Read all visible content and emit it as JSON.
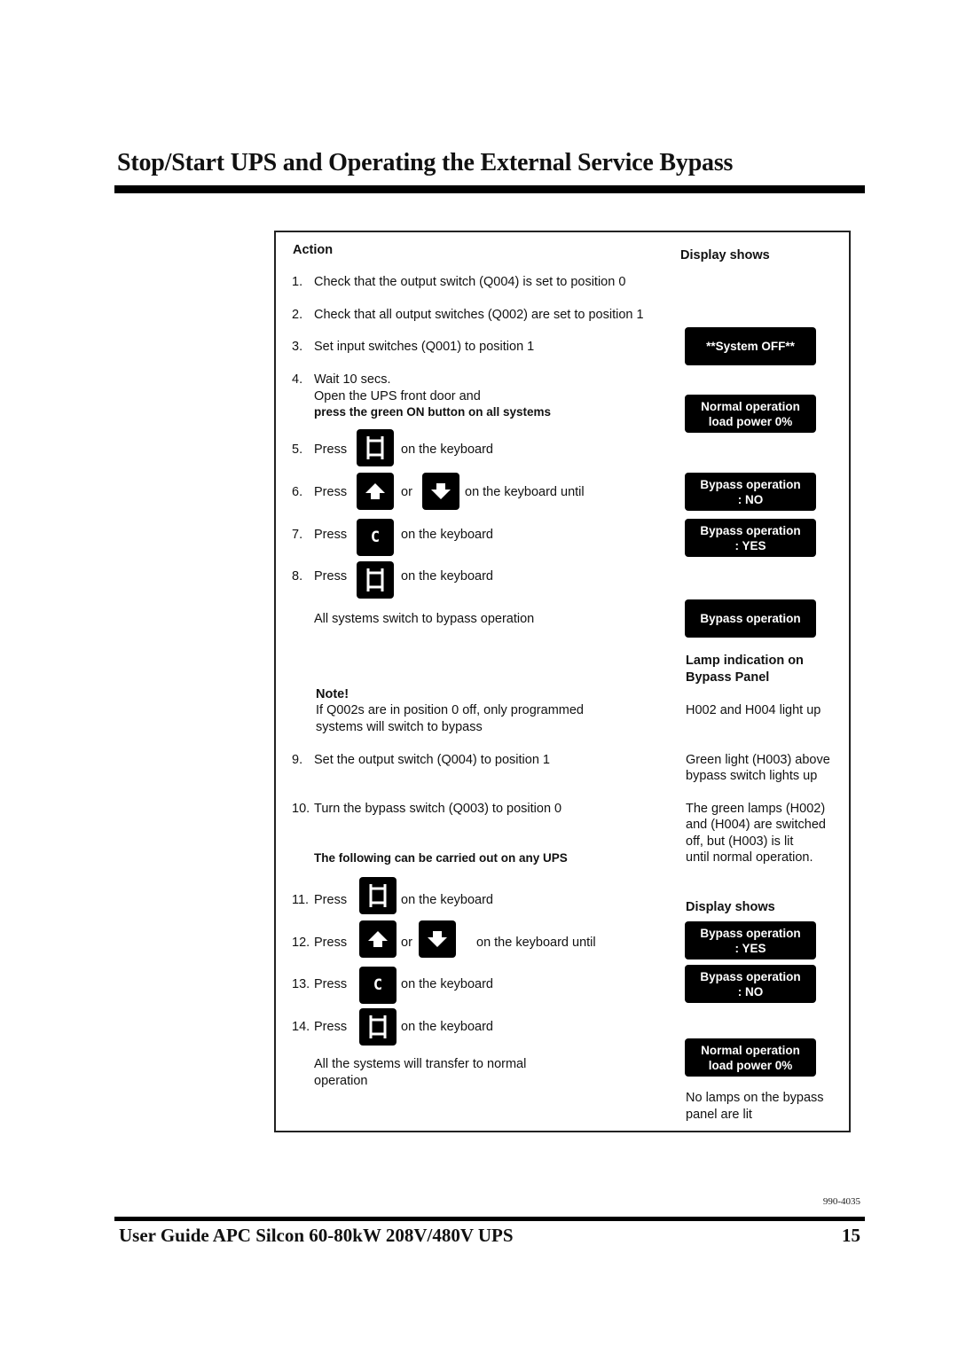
{
  "header": {
    "title": "Stop/Start UPS and Operating the External Service Bypass"
  },
  "table": {
    "col_action": "Action",
    "col_display": "Display shows",
    "steps": [
      {
        "num": "1.",
        "text": "Check that the output switch (Q004) is set to position 0"
      },
      {
        "num": "2.",
        "text": "Check that all output switches (Q002) are set to position 1"
      },
      {
        "num": "3.",
        "text": "Set input switches (Q001) to position 1"
      },
      {
        "num": "4.",
        "line1": "Wait 10 secs.",
        "line2": "Open the UPS front door and",
        "line3_bold": "press the green ON button on all systems"
      },
      {
        "num": "5.",
        "press": "Press",
        "after": "on the keyboard",
        "key": "enter-key"
      },
      {
        "num": "6.",
        "press": "Press",
        "or": "or",
        "after": "on the keyboard until",
        "key1": "up-arrow-key",
        "key2": "down-arrow-key"
      },
      {
        "num": "7.",
        "press": "Press",
        "after": "on the keyboard",
        "key": "c-key",
        "key_label": "C"
      },
      {
        "num": "8.",
        "press": "Press",
        "after": "on the keyboard",
        "key": "enter-key"
      },
      {
        "num": "9.",
        "text": "Set the output switch (Q004) to position 1"
      },
      {
        "num": "10.",
        "text": "Turn the bypass switch (Q003) to position 0"
      },
      {
        "num": "11.",
        "press": "Press",
        "after": "on the keyboard",
        "key": "enter-key"
      },
      {
        "num": "12.",
        "press": "Press",
        "or": "or",
        "after": "on the keyboard until",
        "key1": "up-arrow-key",
        "key2": "down-arrow-key"
      },
      {
        "num": "13.",
        "press": "Press",
        "after": "on the keyboard",
        "key": "c-key",
        "key_label": "C"
      },
      {
        "num": "14.",
        "press": "Press",
        "after": "on the keyboard",
        "key": "enter-key"
      }
    ],
    "bypass_result": "All systems switch to bypass operation",
    "note": {
      "title": "Note!",
      "line1": "If Q002s are in position 0 off, only programmed",
      "line2": "systems will switch to bypass"
    },
    "any_ups": "The following can be carried out on any UPS",
    "normal_result": {
      "line1": "All the systems will transfer to normal",
      "line2": "operation"
    },
    "displays": {
      "system_off": "**System OFF**",
      "normal_op_1": {
        "line1": "Normal operation",
        "line2": "load power 0%"
      },
      "bypass_no_1": {
        "line1": "Bypass operation",
        "line2": ":  NO"
      },
      "bypass_yes_1": {
        "line1": "Bypass operation",
        "line2": ": YES"
      },
      "bypass_op": "Bypass operation",
      "bypass_yes_2": {
        "line1": "Bypass operation",
        "line2": ": YES"
      },
      "bypass_no_2": {
        "line1": "Bypass operation",
        "line2": ":  NO"
      },
      "normal_op_2": {
        "line1": "Normal operation",
        "line2": "load power 0%"
      }
    },
    "lamp_header": {
      "line1": "Lamp indication on",
      "line2": "Bypass Panel"
    },
    "lamps": {
      "h002_h004": "H002 and H004 light up",
      "green_h003": {
        "line1": "Green light (H003) above",
        "line2": "bypass switch lights up"
      },
      "green_lamps": {
        "line1": "The green lamps (H002)",
        "line2": "and (H004) are switched",
        "line3": "off, but (H003) is lit",
        "line4": "until normal operation."
      },
      "no_lamps": {
        "line1": "No lamps on the bypass",
        "line2": "panel are lit"
      }
    },
    "col_display_2": "Display shows"
  },
  "footer": {
    "doc_number": "990-4035",
    "title": "User Guide APC Silcon 60-80kW 208V/480V UPS",
    "page": "15"
  }
}
